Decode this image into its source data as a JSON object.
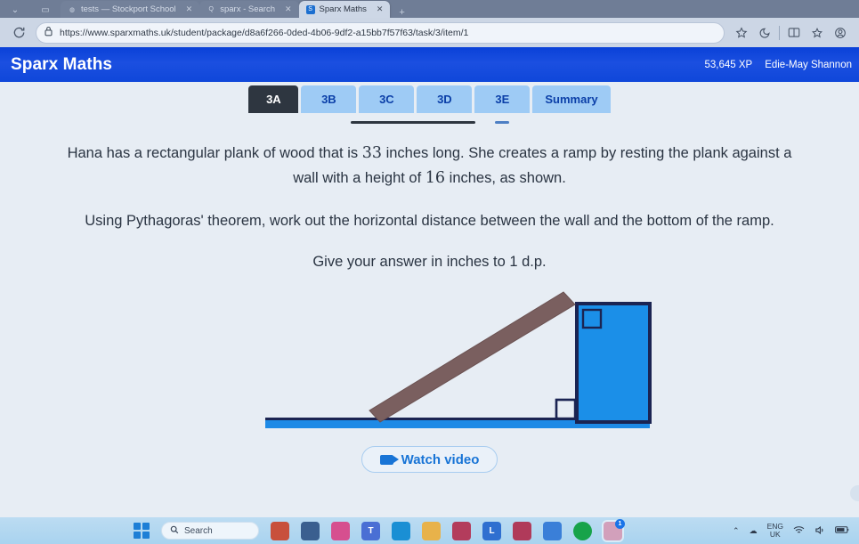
{
  "browser": {
    "tabs": [
      {
        "title": "tests — Stockport School",
        "favicon": "globe-icon",
        "active": false
      },
      {
        "title": "sparx - Search",
        "favicon": "search-icon",
        "active": false
      },
      {
        "title": "Sparx Maths",
        "favicon": "sparx-icon",
        "active": true
      }
    ],
    "new_tab_label": "+",
    "reload_icon": "reload-icon",
    "lock_icon": "lock-icon",
    "url": "https://www.sparxmaths.uk/student/package/d8a6f266-0ded-4b06-9df2-a15bb7f57f63/task/3/item/1",
    "favorite_icon": "star-icon",
    "toolbar_icons": [
      "copilot-icon",
      "split-screen-icon",
      "collections-icon",
      "profile-icon"
    ]
  },
  "app_header": {
    "brand": "Sparx Maths",
    "xp": "53,645 XP",
    "user": "Edie-May Shannon"
  },
  "task_tabs": [
    {
      "label": "3A",
      "active": true
    },
    {
      "label": "3B",
      "active": false
    },
    {
      "label": "3C",
      "active": false
    },
    {
      "label": "3D",
      "active": false
    },
    {
      "label": "3E",
      "active": false
    },
    {
      "label": "Summary",
      "active": false
    }
  ],
  "question": {
    "line1_part1": "Hana has a rectangular plank of wood that is ",
    "length_value": "33",
    "line1_part2": " inches long. She creates a ramp by resting the plank against a wall with a height of ",
    "height_value": "16",
    "line1_part3": " inches, as shown.",
    "paragraph2": "Using Pythagoras' theorem, work out the horizontal distance between the wall and the bottom of the ramp.",
    "paragraph3": "Give your answer in inches to 1 d.p."
  },
  "diagram": {
    "wall_color": "#1b8fe8",
    "wall_outline_color": "#1b2452",
    "ground_color": "#1e8ae6",
    "plank_color": "#7a5f5f",
    "right_angle_marker_color": "#1b2452",
    "description": "Right-angled triangle ramp: brown plank leaning from ground against left face of a blue wall block, with right-angle markers at the top and bottom of the wall."
  },
  "watch_video": {
    "label": "Watch video",
    "icon": "video-camera-icon"
  },
  "taskbar": {
    "start_icon": "windows-start-icon",
    "search_placeholder": "Search",
    "search_icon": "search-icon",
    "apps": [
      {
        "name": "sparx-app-icon",
        "glyph": "",
        "color": "#c8503c"
      },
      {
        "name": "file-explorer-icon",
        "glyph": "",
        "color": "#3a5f8f"
      },
      {
        "name": "copilot-icon",
        "glyph": "",
        "color": "#d64f8f"
      },
      {
        "name": "teams-icon",
        "glyph": "T",
        "color": "#4a6fd4"
      },
      {
        "name": "edge-icon",
        "glyph": "",
        "color": "#1a8fd4"
      },
      {
        "name": "folder-icon",
        "glyph": "",
        "color": "#e8b24a"
      },
      {
        "name": "store-icon",
        "glyph": "",
        "color": "#b33c5c"
      },
      {
        "name": "lightroom-icon",
        "glyph": "L",
        "color": "#2f6fd0"
      },
      {
        "name": "firefox-icon",
        "glyph": "",
        "color": "#b03a5a"
      },
      {
        "name": "drive-icon",
        "glyph": "",
        "color": "#3a7fd8"
      },
      {
        "name": "spotify-icon",
        "glyph": "",
        "color": "#17a34a"
      },
      {
        "name": "photos-icon",
        "glyph": "",
        "color": "#d2a0bb",
        "badge": "1"
      }
    ],
    "tray": {
      "chevron_icon": "chevron-up-icon",
      "cloud_icon": "onedrive-icon",
      "language_line1": "ENG",
      "language_line2": "UK",
      "wifi_icon": "wifi-icon",
      "volume_icon": "volume-icon",
      "battery_icon": "battery-icon"
    }
  }
}
